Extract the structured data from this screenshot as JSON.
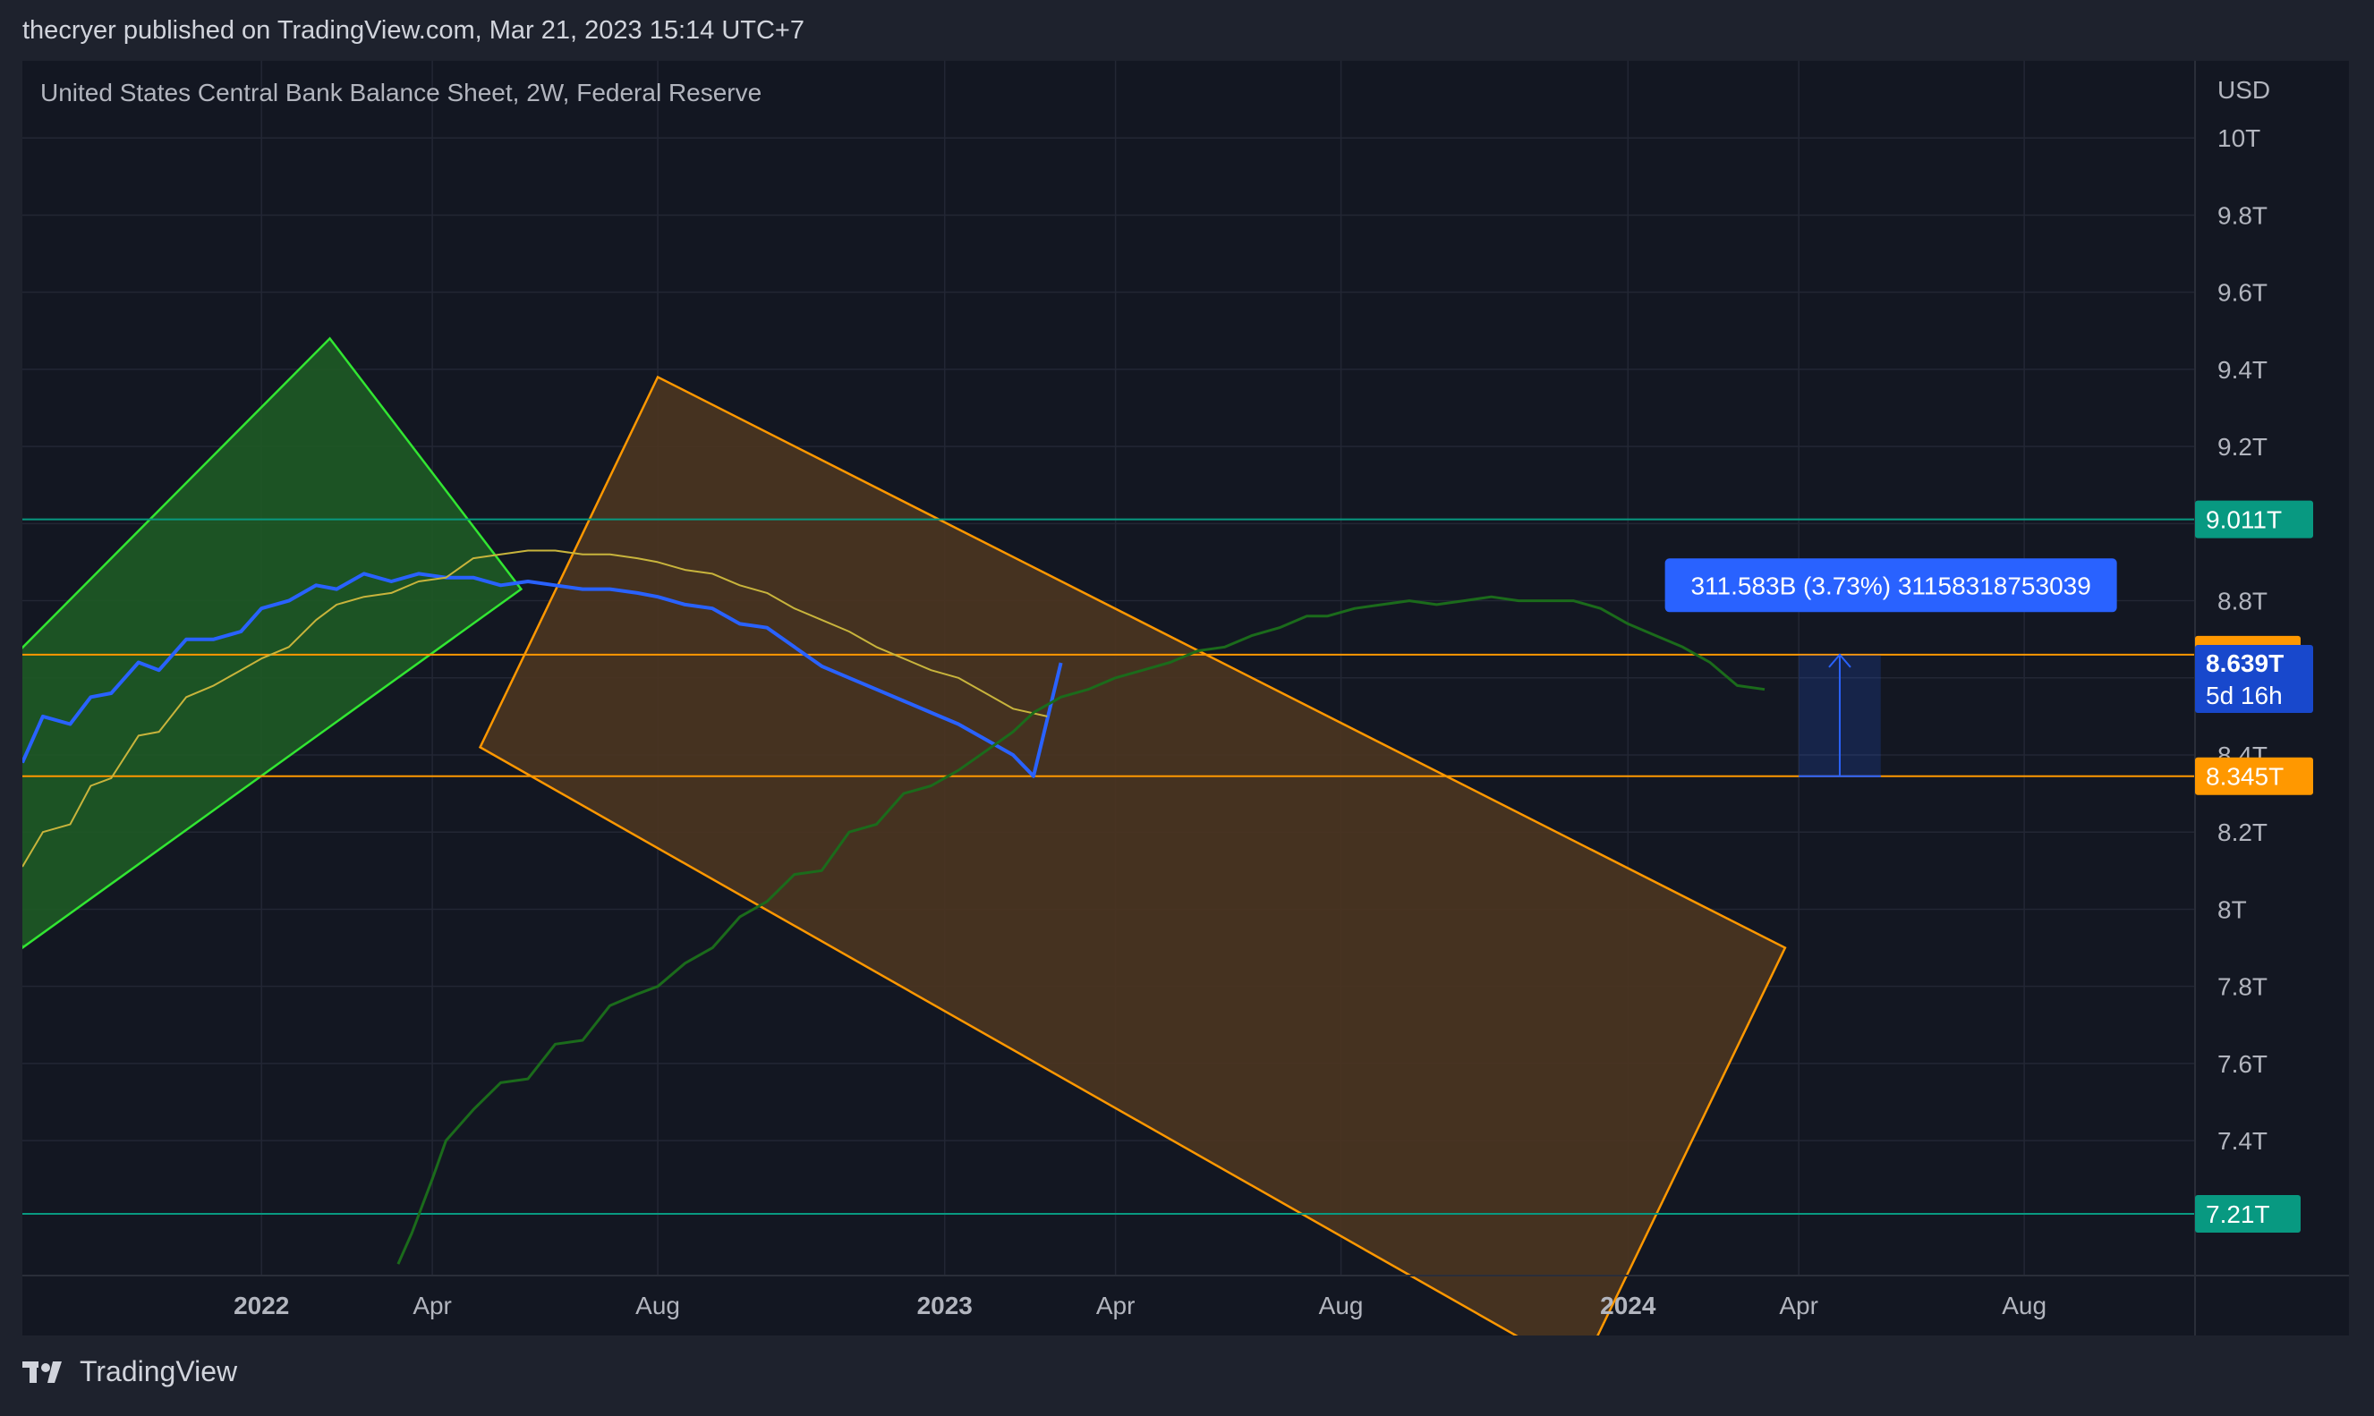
{
  "header": {
    "publisher_line": "thecryer published on TradingView.com, Mar 21, 2023 15:14 UTC+7"
  },
  "footer": {
    "brand": "TradingView",
    "brand_icon": "tradingview-logo-icon"
  },
  "colors": {
    "background": "#131722",
    "grid": "#232734",
    "axis_text": "#b2b5be",
    "main_line": "#2962ff",
    "yellow_line": "#c8b43c",
    "dark_green_line": "#1b6b1b",
    "green_channel": "#32e632",
    "orange_channel": "#ff9800",
    "teal": "#089981",
    "orange_label": "#ff9800",
    "blue_label": "#1848cc"
  },
  "chart_data": {
    "type": "line",
    "title": "United States Central Bank Balance Sheet, 2W, Federal Reserve",
    "currency": "USD",
    "yaxis": {
      "ticks": [
        10,
        9.8,
        9.6,
        9.4,
        9.2,
        9.0,
        8.8,
        8.6,
        8.4,
        8.2,
        8.0,
        7.8,
        7.6,
        7.4
      ],
      "tick_labels": [
        "10T",
        "9.8T",
        "9.6T",
        "9.4T",
        "9.2T",
        "",
        "8.8T",
        "",
        "8.4T",
        "8.2T",
        "8T",
        "7.8T",
        "7.6T",
        "7.4T"
      ],
      "ylim": [
        7.05,
        10.2
      ]
    },
    "xaxis": {
      "tick_labels": [
        "2022",
        "Apr",
        "Aug",
        "2023",
        "Apr",
        "Aug",
        "2024",
        "Apr",
        "Aug"
      ],
      "tick_bold": [
        true,
        false,
        false,
        true,
        false,
        false,
        true,
        false,
        false
      ],
      "tick_positions_x": [
        2022.0,
        2022.25,
        2022.58,
        2023.0,
        2023.25,
        2023.58,
        2024.0,
        2024.25,
        2024.58
      ],
      "xlim": [
        2021.65,
        2024.83
      ]
    },
    "series": [
      {
        "color": "#2962ff",
        "width": 4,
        "points": [
          [
            2021.65,
            8.38
          ],
          [
            2021.68,
            8.5
          ],
          [
            2021.72,
            8.48
          ],
          [
            2021.75,
            8.55
          ],
          [
            2021.78,
            8.56
          ],
          [
            2021.82,
            8.64
          ],
          [
            2021.85,
            8.62
          ],
          [
            2021.89,
            8.7
          ],
          [
            2021.93,
            8.7
          ],
          [
            2021.97,
            8.72
          ],
          [
            2022.0,
            8.78
          ],
          [
            2022.04,
            8.8
          ],
          [
            2022.08,
            8.84
          ],
          [
            2022.11,
            8.83
          ],
          [
            2022.15,
            8.87
          ],
          [
            2022.19,
            8.85
          ],
          [
            2022.23,
            8.87
          ],
          [
            2022.27,
            8.86
          ],
          [
            2022.31,
            8.86
          ],
          [
            2022.35,
            8.84
          ],
          [
            2022.39,
            8.85
          ],
          [
            2022.43,
            8.84
          ],
          [
            2022.47,
            8.83
          ],
          [
            2022.51,
            8.83
          ],
          [
            2022.55,
            8.82
          ],
          [
            2022.58,
            8.81
          ],
          [
            2022.62,
            8.79
          ],
          [
            2022.66,
            8.78
          ],
          [
            2022.7,
            8.74
          ],
          [
            2022.74,
            8.73
          ],
          [
            2022.78,
            8.68
          ],
          [
            2022.82,
            8.63
          ],
          [
            2022.86,
            8.6
          ],
          [
            2022.9,
            8.57
          ],
          [
            2022.94,
            8.54
          ],
          [
            2022.98,
            8.51
          ],
          [
            2023.02,
            8.48
          ],
          [
            2023.06,
            8.44
          ],
          [
            2023.1,
            8.4
          ],
          [
            2023.13,
            8.345
          ],
          [
            2023.17,
            8.639
          ]
        ]
      },
      {
        "color": "#c8b43c",
        "width": 2,
        "points": [
          [
            2021.65,
            8.11
          ],
          [
            2021.68,
            8.2
          ],
          [
            2021.72,
            8.22
          ],
          [
            2021.75,
            8.32
          ],
          [
            2021.78,
            8.34
          ],
          [
            2021.82,
            8.45
          ],
          [
            2021.85,
            8.46
          ],
          [
            2021.89,
            8.55
          ],
          [
            2021.93,
            8.58
          ],
          [
            2021.97,
            8.62
          ],
          [
            2022.0,
            8.65
          ],
          [
            2022.04,
            8.68
          ],
          [
            2022.08,
            8.75
          ],
          [
            2022.11,
            8.79
          ],
          [
            2022.15,
            8.81
          ],
          [
            2022.19,
            8.82
          ],
          [
            2022.23,
            8.85
          ],
          [
            2022.27,
            8.86
          ],
          [
            2022.31,
            8.91
          ],
          [
            2022.35,
            8.92
          ],
          [
            2022.39,
            8.93
          ],
          [
            2022.43,
            8.93
          ],
          [
            2022.47,
            8.92
          ],
          [
            2022.51,
            8.92
          ],
          [
            2022.55,
            8.91
          ],
          [
            2022.58,
            8.9
          ],
          [
            2022.62,
            8.88
          ],
          [
            2022.66,
            8.87
          ],
          [
            2022.7,
            8.84
          ],
          [
            2022.74,
            8.82
          ],
          [
            2022.78,
            8.78
          ],
          [
            2022.82,
            8.75
          ],
          [
            2022.86,
            8.72
          ],
          [
            2022.9,
            8.68
          ],
          [
            2022.94,
            8.65
          ],
          [
            2022.98,
            8.62
          ],
          [
            2023.02,
            8.6
          ],
          [
            2023.06,
            8.56
          ],
          [
            2023.1,
            8.52
          ],
          [
            2023.15,
            8.5
          ]
        ]
      },
      {
        "color": "#1b6b1b",
        "width": 3,
        "points": [
          [
            2022.2,
            7.08
          ],
          [
            2022.22,
            7.16
          ],
          [
            2022.25,
            7.3
          ],
          [
            2022.27,
            7.4
          ],
          [
            2022.31,
            7.48
          ],
          [
            2022.35,
            7.55
          ],
          [
            2022.39,
            7.56
          ],
          [
            2022.43,
            7.65
          ],
          [
            2022.47,
            7.66
          ],
          [
            2022.51,
            7.75
          ],
          [
            2022.55,
            7.78
          ],
          [
            2022.58,
            7.8
          ],
          [
            2022.62,
            7.86
          ],
          [
            2022.66,
            7.9
          ],
          [
            2022.7,
            7.98
          ],
          [
            2022.74,
            8.02
          ],
          [
            2022.78,
            8.09
          ],
          [
            2022.82,
            8.1
          ],
          [
            2022.86,
            8.2
          ],
          [
            2022.9,
            8.22
          ],
          [
            2022.94,
            8.3
          ],
          [
            2022.98,
            8.32
          ],
          [
            2023.02,
            8.36
          ],
          [
            2023.06,
            8.41
          ],
          [
            2023.1,
            8.46
          ],
          [
            2023.13,
            8.51
          ],
          [
            2023.17,
            8.55
          ],
          [
            2023.21,
            8.57
          ],
          [
            2023.25,
            8.6
          ],
          [
            2023.29,
            8.62
          ],
          [
            2023.33,
            8.64
          ],
          [
            2023.37,
            8.67
          ],
          [
            2023.41,
            8.68
          ],
          [
            2023.45,
            8.71
          ],
          [
            2023.49,
            8.73
          ],
          [
            2023.53,
            8.76
          ],
          [
            2023.56,
            8.76
          ],
          [
            2023.6,
            8.78
          ],
          [
            2023.64,
            8.79
          ],
          [
            2023.68,
            8.8
          ],
          [
            2023.72,
            8.79
          ],
          [
            2023.76,
            8.8
          ],
          [
            2023.8,
            8.81
          ],
          [
            2023.84,
            8.8
          ],
          [
            2023.88,
            8.8
          ],
          [
            2023.92,
            8.8
          ],
          [
            2023.96,
            8.78
          ],
          [
            2024.0,
            8.74
          ],
          [
            2024.04,
            8.71
          ],
          [
            2024.08,
            8.68
          ],
          [
            2024.12,
            8.64
          ],
          [
            2024.16,
            8.58
          ],
          [
            2024.2,
            8.57
          ]
        ]
      }
    ],
    "horizontal_lines": [
      {
        "y": 9.011,
        "label": "9.011T",
        "color": "#089981",
        "label_bg": "#089981"
      },
      {
        "y": 8.66,
        "label": "8.66T",
        "color": "#ff9800",
        "label_bg": "#ff9800"
      },
      {
        "y": 8.345,
        "label": "8.345T",
        "color": "#ff9800",
        "label_bg": "#ff9800"
      },
      {
        "y": 7.21,
        "label": "7.21T",
        "color": "#089981",
        "label_bg": "#089981"
      }
    ],
    "last_value": {
      "label": "8.639T",
      "countdown": "5d 16h",
      "y": 8.639,
      "bg": "#1848cc"
    },
    "channels": [
      {
        "stroke": "#32e632",
        "fill": "#1e5a25",
        "points": [
          [
            2021.55,
            8.5
          ],
          [
            2022.1,
            9.48
          ],
          [
            2022.38,
            8.83
          ],
          [
            2021.65,
            7.9
          ]
        ]
      },
      {
        "stroke": "#ff9800",
        "fill": "#4b3520",
        "points": [
          [
            2022.32,
            8.42
          ],
          [
            2022.58,
            9.38
          ],
          [
            2024.23,
            7.9
          ],
          [
            2023.93,
            6.8
          ],
          [
            2022.32,
            8.42
          ]
        ]
      }
    ],
    "measure": {
      "label": "311.583B (3.73%) 31158318753039",
      "x0": 2024.25,
      "x1": 2024.37,
      "y_low": 8.345,
      "y_high": 8.66,
      "label_x": 2024.1,
      "label_y": 8.84
    }
  }
}
